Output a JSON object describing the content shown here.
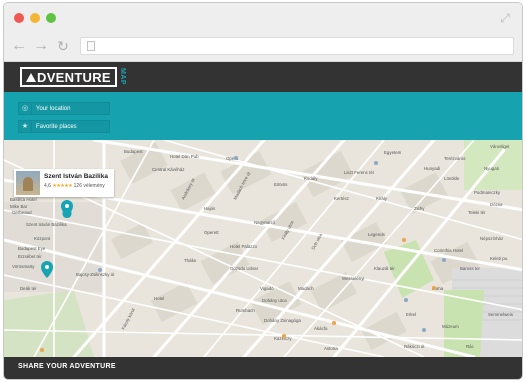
{
  "browser": {
    "url": ""
  },
  "app": {
    "logo_text": "DVENTURE",
    "logo_sub": "MAP"
  },
  "sidebar": {
    "buttons": [
      {
        "label": "Your location",
        "icon": "location-icon"
      },
      {
        "label": "Favorite places",
        "icon": "star-icon"
      }
    ]
  },
  "place_card": {
    "name": "Szent István Bazilika",
    "rating": "4,6",
    "stars": "★★★★★",
    "reviews": "126 vélemény"
  },
  "map_labels": [
    "Hotel Dán Pub",
    "Opera",
    "Andrássy út",
    "Central Kávéház",
    "Budapest",
    "Basilica Hotel",
    "Szent István Bazilika",
    "Gerbeaud",
    "Mike Bar",
    "Központ",
    "Bajcsy-Zsilinszky út",
    "Liszt Ferenc tér",
    "Egyetem",
    "Madách Imre út",
    "Legends",
    "Király utca",
    "Dob utca",
    "Nyugati",
    "Erzsébet tér",
    "Budapest Eye",
    "Gozsdu Udvar",
    "Hotel",
    "Deák tér",
    "Károly körút",
    "Dohány utca",
    "Rumbach",
    "Kazinczy",
    "Akácfa",
    "Wesselényi",
    "Madách",
    "Kertész",
    "Klauzál tér",
    "Vörösmarty",
    "Dohány Zsinagóga",
    "Astoria",
    "Múzeum",
    "Rákóczi út",
    "Keleti pu.",
    "Baross tér",
    "Népszínház",
    "Teleki tér",
    "Blaha",
    "Corinthia Hotel",
    "Hotel Palazzo",
    "Vigadó",
    "Operett",
    "Thália",
    "Rác",
    "Kodály",
    "Király",
    "Semmelweis",
    "Erkel",
    "Nagymező",
    "Hajós",
    "Zichy",
    "Podmaniczky",
    "Terézváros",
    "Eötvös",
    "Hunyadi",
    "Lövölde",
    "Városliget",
    "Dózsa"
  ],
  "footer": {
    "label": "SHARE YOUR ADVENTURE"
  },
  "colors": {
    "header_dark": "#333333",
    "teal": "#17a2b0",
    "map_bg": "#e9e5dc",
    "park": "#c8e3b0",
    "marker": "#17a5b3"
  }
}
